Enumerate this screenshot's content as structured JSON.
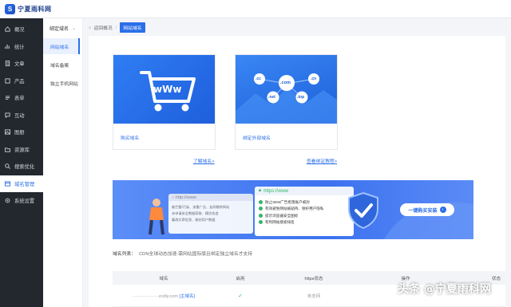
{
  "app": {
    "logo_text": "宁夏雨科网",
    "logo_mark": "S"
  },
  "sidebar": {
    "items": [
      {
        "label": "概况",
        "icon": "home-icon"
      },
      {
        "label": "统计",
        "icon": "stats-icon"
      },
      {
        "label": "文章",
        "icon": "article-icon"
      },
      {
        "label": "产品",
        "icon": "product-icon"
      },
      {
        "label": "表单",
        "icon": "form-icon"
      },
      {
        "label": "互动",
        "icon": "chat-icon"
      },
      {
        "label": "图册",
        "icon": "image-icon"
      },
      {
        "label": "资源库",
        "icon": "folder-icon"
      },
      {
        "label": "搜索优化",
        "icon": "search-icon"
      },
      {
        "label": "域名管理",
        "icon": "domain-icon"
      },
      {
        "label": "系统设置",
        "icon": "gear-icon"
      }
    ],
    "active_index": 9
  },
  "subnav": {
    "group_label": "绑定域名",
    "items": [
      {
        "label": "网站域名",
        "active": true
      },
      {
        "label": "域名备案",
        "active": false
      },
      {
        "label": "独立手机网站",
        "active": false
      }
    ]
  },
  "breadcrumb": {
    "back": "返回概况",
    "current": "网站域名"
  },
  "cards": {
    "buy": {
      "caption": "购买域名",
      "art_text": "wWw"
    },
    "bind": {
      "caption": "绑定外部域名",
      "tlds": [
        ".cc",
        ".com",
        ".cn",
        ".net",
        ".top"
      ]
    }
  },
  "links": {
    "learn": "了解域名>",
    "tutorial": "查看绑定教程>"
  },
  "banner": {
    "url_left": "http://www",
    "url_right": "https://www",
    "left_items": [
      "被拦截/污染、流量广告、友网跳转网站",
      "未申请安全数据获取、模仿伪造",
      "篡改文章信息、偷窃用户数据"
    ],
    "right_items": [
      "防止SEM广告拒落账户被封",
      "有效避免网站被劫持、保护用户隐私",
      "提示浏览器安全图标",
      "有利网站搜索排名"
    ],
    "cta": "一键购买安装"
  },
  "domain_list": {
    "label": "域名列表：",
    "note": "CDN全球动态加速-需网站国际版且绑定独立域名才支持"
  },
  "table": {
    "headers": [
      "域名",
      "启用",
      "https状态",
      "操作",
      "状态"
    ],
    "row": {
      "domain": "··················zcdly.com",
      "domain_tag": "[主域名]",
      "https": "未支持"
    }
  },
  "watermark": "头条 @宁夏雨科网",
  "colors": {
    "accent": "#2a6fe8",
    "sidebar_bg": "#23272e"
  }
}
